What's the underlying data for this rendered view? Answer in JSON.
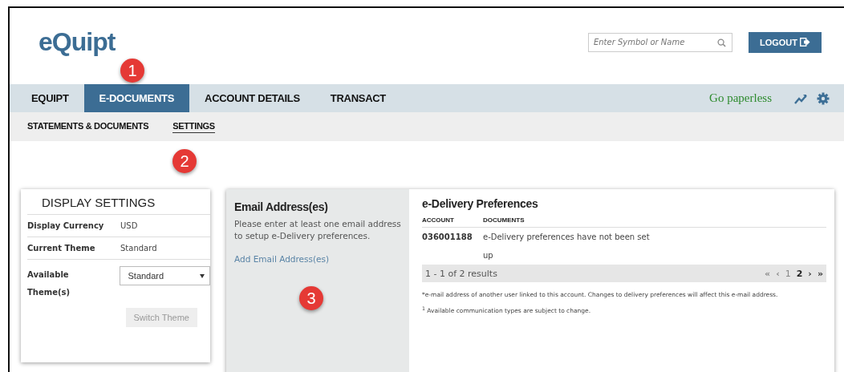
{
  "logo": "eQuipt",
  "search": {
    "placeholder": "Enter Symbol or Name"
  },
  "logout": {
    "label": "LOGOUT"
  },
  "nav": {
    "tabs": [
      {
        "label": "EQUIPT",
        "selected": false
      },
      {
        "label": "E-DOCUMENTS",
        "selected": true
      },
      {
        "label": "ACCOUNT DETAILS",
        "selected": false
      },
      {
        "label": "TRANSACT",
        "selected": false
      }
    ],
    "paperless": "Go paperless"
  },
  "subnav": [
    {
      "label": "STATEMENTS & DOCUMENTS",
      "selected": false
    },
    {
      "label": "SETTINGS",
      "selected": true
    }
  ],
  "annotations": [
    "1",
    "2",
    "3"
  ],
  "display_settings": {
    "title": "DISPLAY SETTINGS",
    "rows": [
      {
        "label": "Display Currency",
        "value": "USD"
      },
      {
        "label": "Current Theme",
        "value": "Standard"
      }
    ],
    "available": {
      "label": "Available Theme(s)",
      "value": "Standard"
    },
    "button": {
      "label": "Switch Theme",
      "disabled": true
    }
  },
  "email": {
    "title": "Email Address(es)",
    "text": "Please enter at least one email address to setup e-Delivery preferences.",
    "link": "Add Email Address(es)"
  },
  "delivery": {
    "title": "e-Delivery Preferences",
    "columns": [
      "ACCOUNT",
      "DOCUMENTS"
    ],
    "rows": [
      {
        "account": "036001188",
        "documents": [
          "e-Delivery preferences have not been set",
          "up"
        ]
      }
    ],
    "results": "1 - 1 of 2 results",
    "pager": [
      {
        "label": "«",
        "kind": "arrow",
        "disabled": true
      },
      {
        "label": "‹",
        "kind": "arrow",
        "disabled": true
      },
      {
        "label": "1",
        "kind": "page",
        "selected": false
      },
      {
        "label": "2",
        "kind": "page",
        "selected": true
      },
      {
        "label": "›",
        "kind": "arrow",
        "disabled": false
      },
      {
        "label": "»",
        "kind": "arrow",
        "disabled": false
      }
    ],
    "notes": [
      "*e-mail address of another user linked to this account. Changes to delivery preferences will affect this e-mail address.",
      "$^{1}$ Available communication types are subject to change."
    ]
  }
}
